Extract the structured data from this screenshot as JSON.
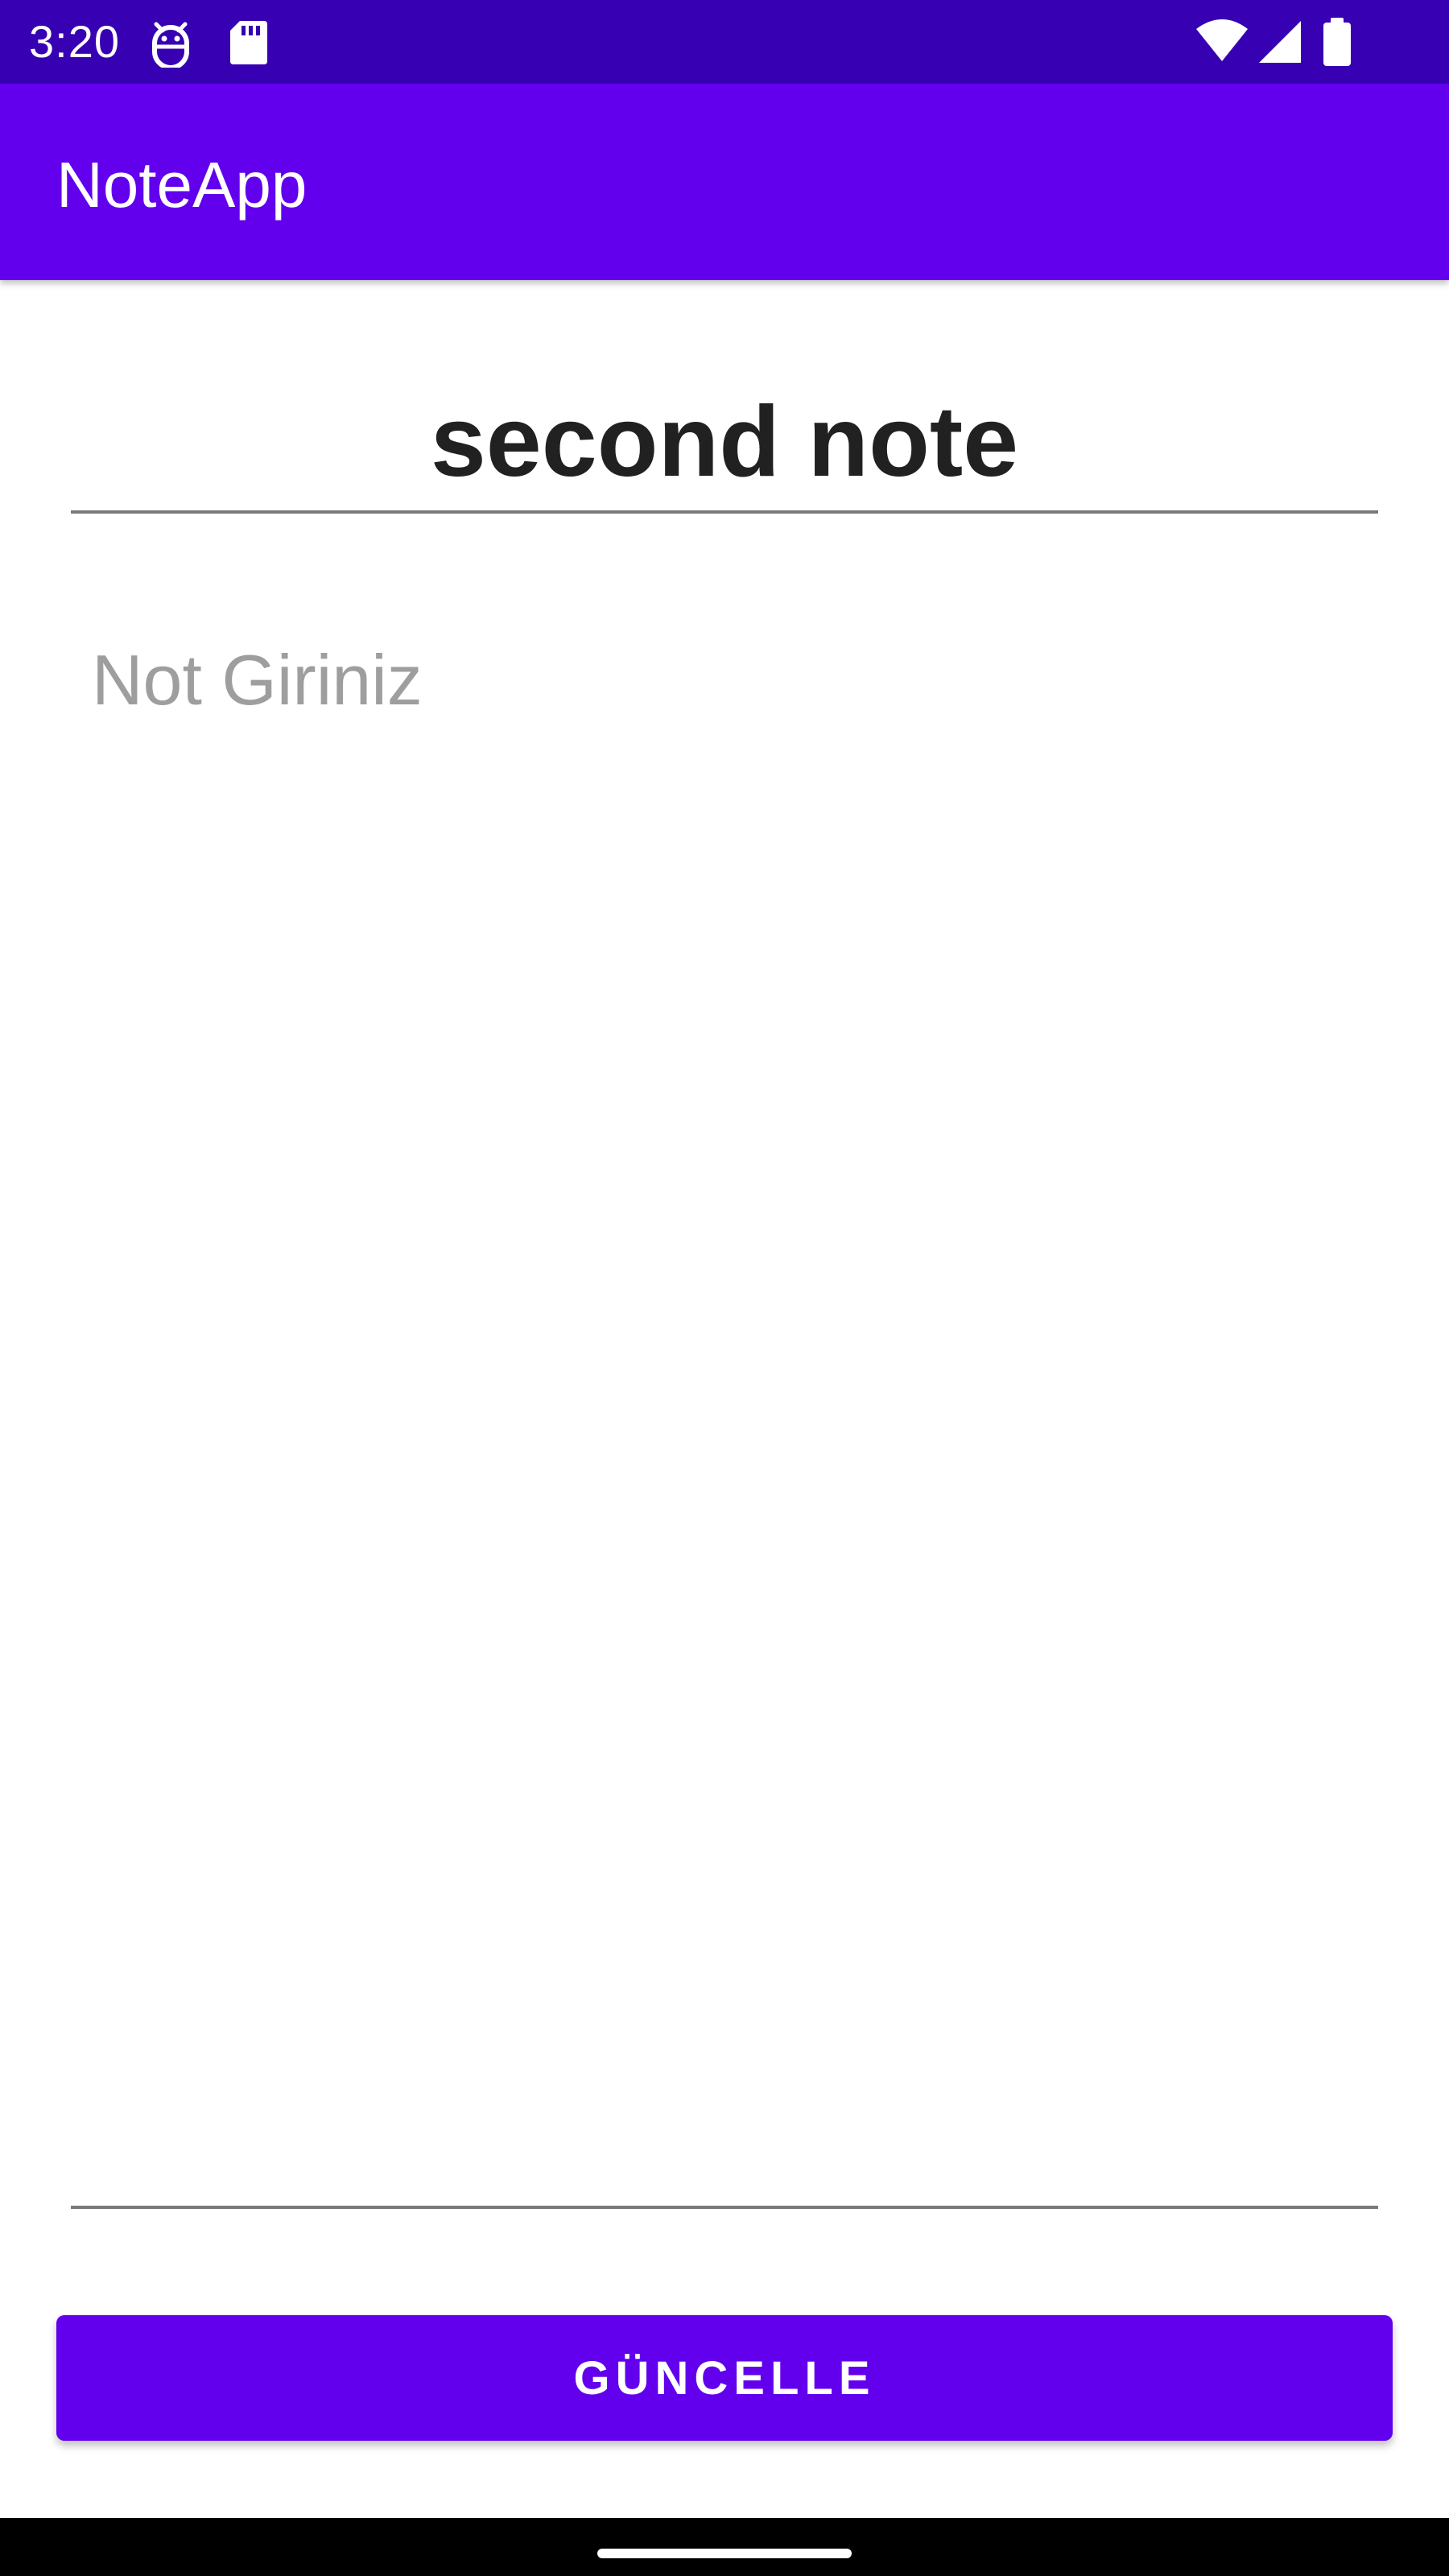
{
  "status_bar": {
    "time": "3:20",
    "background_color": "#3700B3",
    "left_icons": [
      "android-debug-icon",
      "sd-card-icon"
    ],
    "right_icons": [
      "wifi-icon",
      "cellular-signal-icon",
      "battery-icon"
    ]
  },
  "app_bar": {
    "title": "NoteApp",
    "background_color": "#6200EE"
  },
  "note": {
    "title_value": "second note",
    "body_value": "",
    "body_placeholder": "Not Giriniz"
  },
  "actions": {
    "update_label": "GÜNCELLE",
    "button_color": "#6200EE"
  },
  "nav_bar": {
    "handle": "home-gesture-handle"
  }
}
